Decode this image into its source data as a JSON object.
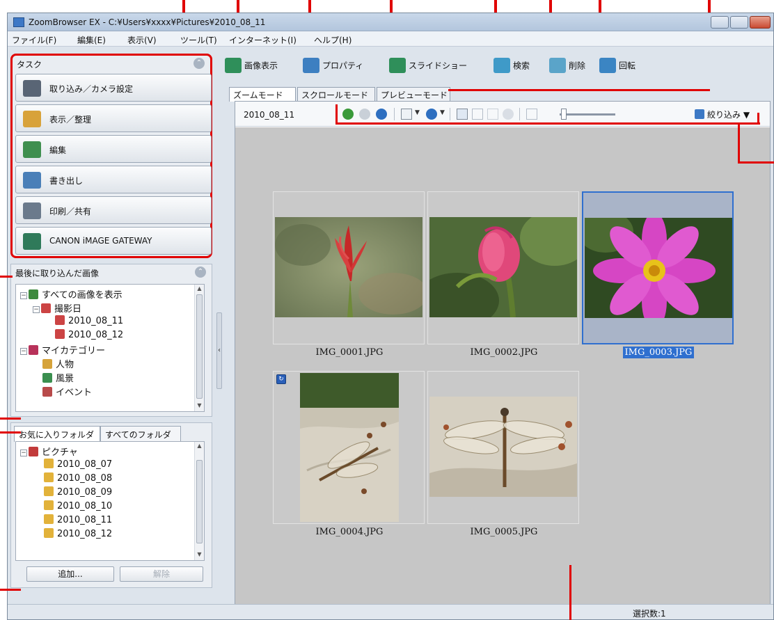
{
  "window": {
    "title": "ZoomBrowser EX  -  C:¥Users¥xxxx¥Pictures¥2010_08_11"
  },
  "menu": [
    "ファイル(F)",
    "編集(E)",
    "表示(V)",
    "ツール(T)",
    "インターネット(I)",
    "ヘルプ(H)"
  ],
  "tasks": {
    "title": "タスク",
    "buttons": [
      {
        "label": "取り込み／カメラ設定",
        "icon": "import-camera-icon",
        "color": "#596575"
      },
      {
        "label": "表示／整理",
        "icon": "view-organize-icon",
        "color": "#d8a23a"
      },
      {
        "label": "編集",
        "icon": "edit-icon",
        "color": "#3f8f4f"
      },
      {
        "label": "書き出し",
        "icon": "export-icon",
        "color": "#4a7fb8"
      },
      {
        "label": "印刷／共有",
        "icon": "print-share-icon",
        "color": "#6b7a8c"
      },
      {
        "label": "CANON iMAGE GATEWAY",
        "icon": "canon-gateway-icon",
        "color": "#2f7a5a"
      }
    ]
  },
  "recent": {
    "title": "最後に取り込んだ画像",
    "tree": [
      {
        "label": "すべての画像を表示",
        "icon": "all-images-icon",
        "color": "#3d8a3d"
      },
      {
        "label": "撮影日",
        "icon": "calendar-icon",
        "color": "#c44"
      },
      {
        "label": "2010_08_11",
        "icon": "date-icon",
        "color": "#c44"
      },
      {
        "label": "2010_08_12",
        "icon": "date-icon",
        "color": "#c44"
      },
      {
        "label": "マイカテゴリー",
        "icon": "category-icon",
        "color": "#b8325a"
      },
      {
        "label": "人物",
        "icon": "person-icon",
        "color": "#d6a33a"
      },
      {
        "label": "風景",
        "icon": "landscape-icon",
        "color": "#3a8f4f"
      },
      {
        "label": "イベント",
        "icon": "event-icon",
        "color": "#b84a4a"
      }
    ]
  },
  "folders": {
    "tabs": [
      "お気に入りフォルダ",
      "すべてのフォルダ"
    ],
    "root": "ピクチャ",
    "items": [
      "2010_08_07",
      "2010_08_08",
      "2010_08_09",
      "2010_08_10",
      "2010_08_11",
      "2010_08_12"
    ],
    "add_label": "追加...",
    "remove_label": "解除"
  },
  "toolbar": [
    {
      "label": "画像表示",
      "icon": "image-view-icon",
      "color": "#2f8f5a"
    },
    {
      "label": "プロパティ",
      "icon": "properties-icon",
      "color": "#3d7fc1"
    },
    {
      "label": "スライドショー",
      "icon": "slideshow-icon",
      "color": "#2f8f5a"
    },
    {
      "label": "検索",
      "icon": "search-icon",
      "color": "#3f9ac8"
    },
    {
      "label": "削除",
      "icon": "delete-icon",
      "color": "#5aa4c9"
    },
    {
      "label": "回転",
      "icon": "rotate-icon",
      "color": "#3b85c3"
    }
  ],
  "view_tabs": [
    "ズームモード",
    "スクロールモード",
    "プレビューモード"
  ],
  "viewer": {
    "folder": "2010_08_11",
    "filter_label": "絞り込み"
  },
  "images": [
    {
      "name": "IMG_0001.JPG",
      "selected": false
    },
    {
      "name": "IMG_0002.JPG",
      "selected": false
    },
    {
      "name": "IMG_0003.JPG",
      "selected": true
    },
    {
      "name": "IMG_0004.JPG",
      "selected": false
    },
    {
      "name": "IMG_0005.JPG",
      "selected": false
    }
  ],
  "status": {
    "selection_count": "選択数:1"
  },
  "colors": {
    "accent": "#2f6fcf",
    "callout": "#e00000"
  }
}
